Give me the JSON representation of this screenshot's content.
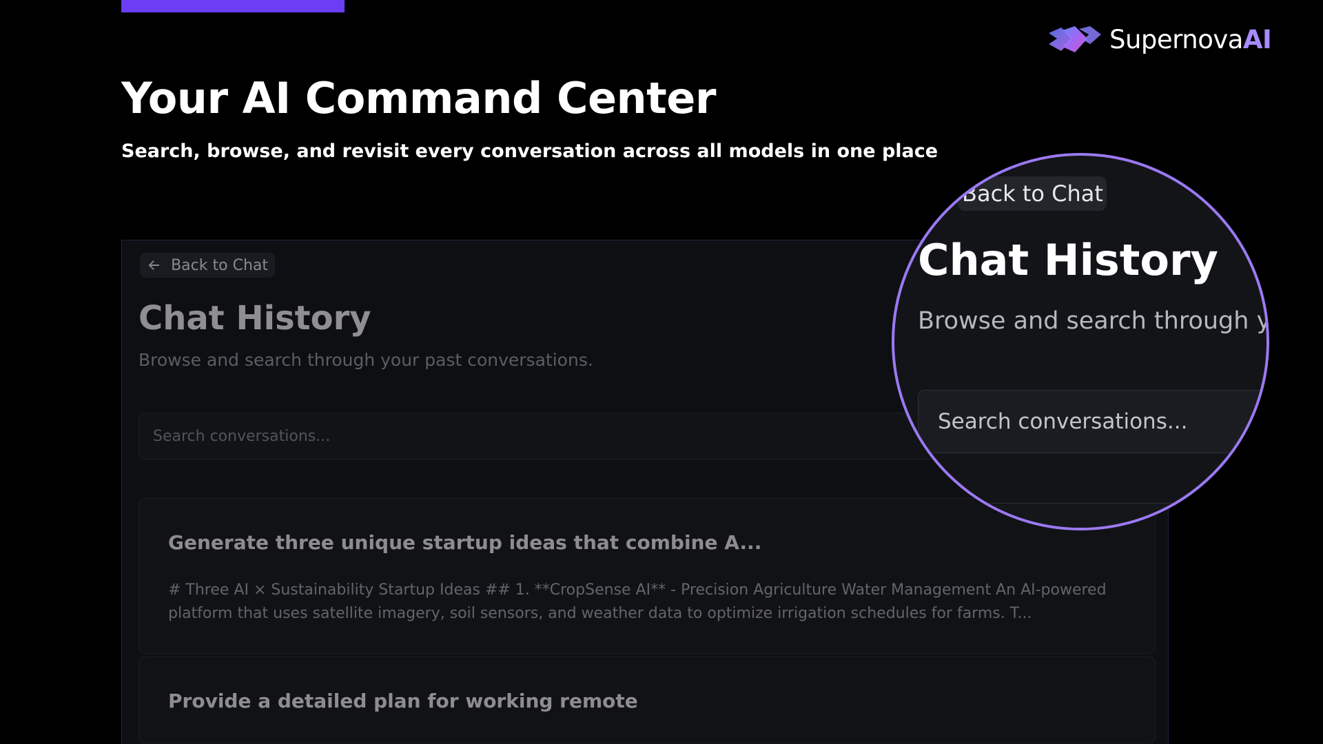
{
  "brand": {
    "name_primary": "Supernova",
    "name_accent": "AI",
    "logo_icon": "chevrons-gradient-icon",
    "accent_color": "#6d3cf5",
    "ring_color": "#9b79f2"
  },
  "hero": {
    "title": "Your AI Command Center",
    "subtitle": "Search, browse, and revisit every conversation across all models in one place"
  },
  "app": {
    "back_label": "Back to Chat",
    "back_icon": "arrow-left-icon",
    "page_title": "Chat History",
    "page_subtitle": "Browse and search through your past conversations.",
    "search_placeholder": "Search conversations...",
    "conversations": [
      {
        "title": "Generate three unique startup ideas that combine A...",
        "preview": "# Three AI × Sustainability Startup Ideas ## 1. **CropSense AI** - Precision Agriculture Water Management An AI-powered platform that uses satellite imagery, soil sensors, and weather data to optimize irrigation schedules for farms. T..."
      },
      {
        "title": "Provide a detailed plan for working remote",
        "preview": ""
      }
    ]
  },
  "magnifier": {
    "back_label": "Back to Chat",
    "page_title": "Chat History",
    "page_subtitle": "Browse and search through yo",
    "search_placeholder": "Search conversations..."
  }
}
